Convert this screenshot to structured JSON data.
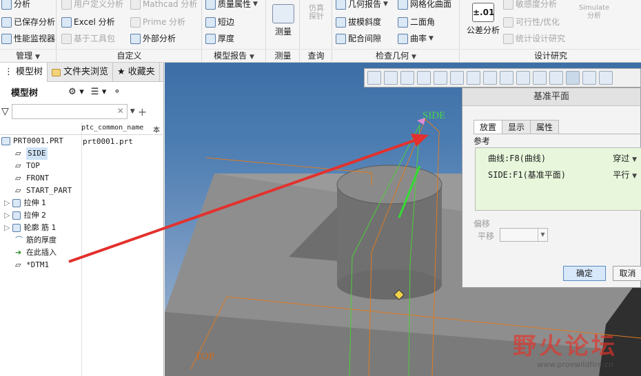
{
  "ribbon": {
    "col1": {
      "items": [
        "分析",
        "已保存分析",
        "性能监视器"
      ],
      "group_label": "管理"
    },
    "col2": {
      "items": [
        "用户定义分析",
        "Excel 分析",
        "基于工具包"
      ],
      "group_label": "自定义"
    },
    "col3": {
      "items": [
        "Mathcad 分析",
        "Prime 分析",
        "外部分析"
      ]
    },
    "col4": {
      "items": [
        "质量属性",
        "短边",
        "厚度"
      ],
      "group_label": "模型报告"
    },
    "measure": {
      "label": "测量",
      "group_label": "测量"
    },
    "probe": {
      "label": "仿真\n探针",
      "group_label": "查询"
    },
    "col5": {
      "items": [
        "几何报告",
        "拔模斜度",
        "配合间隙"
      ]
    },
    "col6": {
      "items": [
        "网格化曲面",
        "二面角",
        "曲率"
      ],
      "group_label": "检查几何"
    },
    "tolerance": {
      "label": "公差分析",
      "icon_text": "±.01"
    },
    "col7": {
      "items": [
        "敏感度分析",
        "可行性/优化",
        "统计设计研究"
      ],
      "group_label": "设计研究"
    },
    "simulate": {
      "label": "Simulate\n分析"
    }
  },
  "left_panel": {
    "tabs": [
      "模型树",
      "文件夹浏览",
      "收藏夹"
    ],
    "tree_title": "模型树",
    "column_header": "ptc_common_name",
    "column_header_2": "本",
    "root_value": "prt0001.prt",
    "items": [
      {
        "label": "PRT0001.PRT",
        "icon": "part-icon"
      },
      {
        "label": "SIDE",
        "icon": "datum-plane-icon",
        "selected": true
      },
      {
        "label": "TOP",
        "icon": "datum-plane-icon"
      },
      {
        "label": "FRONT",
        "icon": "datum-plane-icon"
      },
      {
        "label": "START_PART",
        "icon": "datum-plane-icon"
      },
      {
        "label": "拉伸 1",
        "icon": "extrude-icon"
      },
      {
        "label": "拉伸 2",
        "icon": "extrude-icon"
      },
      {
        "label": "轮廓 筋 1",
        "icon": "rib-icon"
      },
      {
        "label": "筋的厚度",
        "icon": "thicken-icon"
      },
      {
        "label": "在此插入",
        "icon": "insert-here-icon"
      },
      {
        "label": "*DTM1",
        "icon": "datum-plane-icon"
      }
    ]
  },
  "viewport": {
    "label_side": "SIDE",
    "label_top": "TOP",
    "watermark": "野火论坛",
    "watermark_url": "www.proewildfire.cn"
  },
  "dialog": {
    "title": "基准平面",
    "tabs": [
      "放置",
      "显示",
      "属性"
    ],
    "ref_label": "参考",
    "refs": [
      {
        "name": "曲线:F8(曲线)",
        "constraint": "穿过"
      },
      {
        "name": "SIDE:F1(基准平面)",
        "constraint": "平行"
      }
    ],
    "offset_label": "偏移",
    "translate_label": "平移",
    "translate_value": "",
    "ok": "确定",
    "cancel": "取消"
  },
  "colors": {
    "arrow": "#e3312d",
    "edge": "#e07a1f",
    "green": "#4ecf3a",
    "selected_bg": "#cfe3f7"
  }
}
